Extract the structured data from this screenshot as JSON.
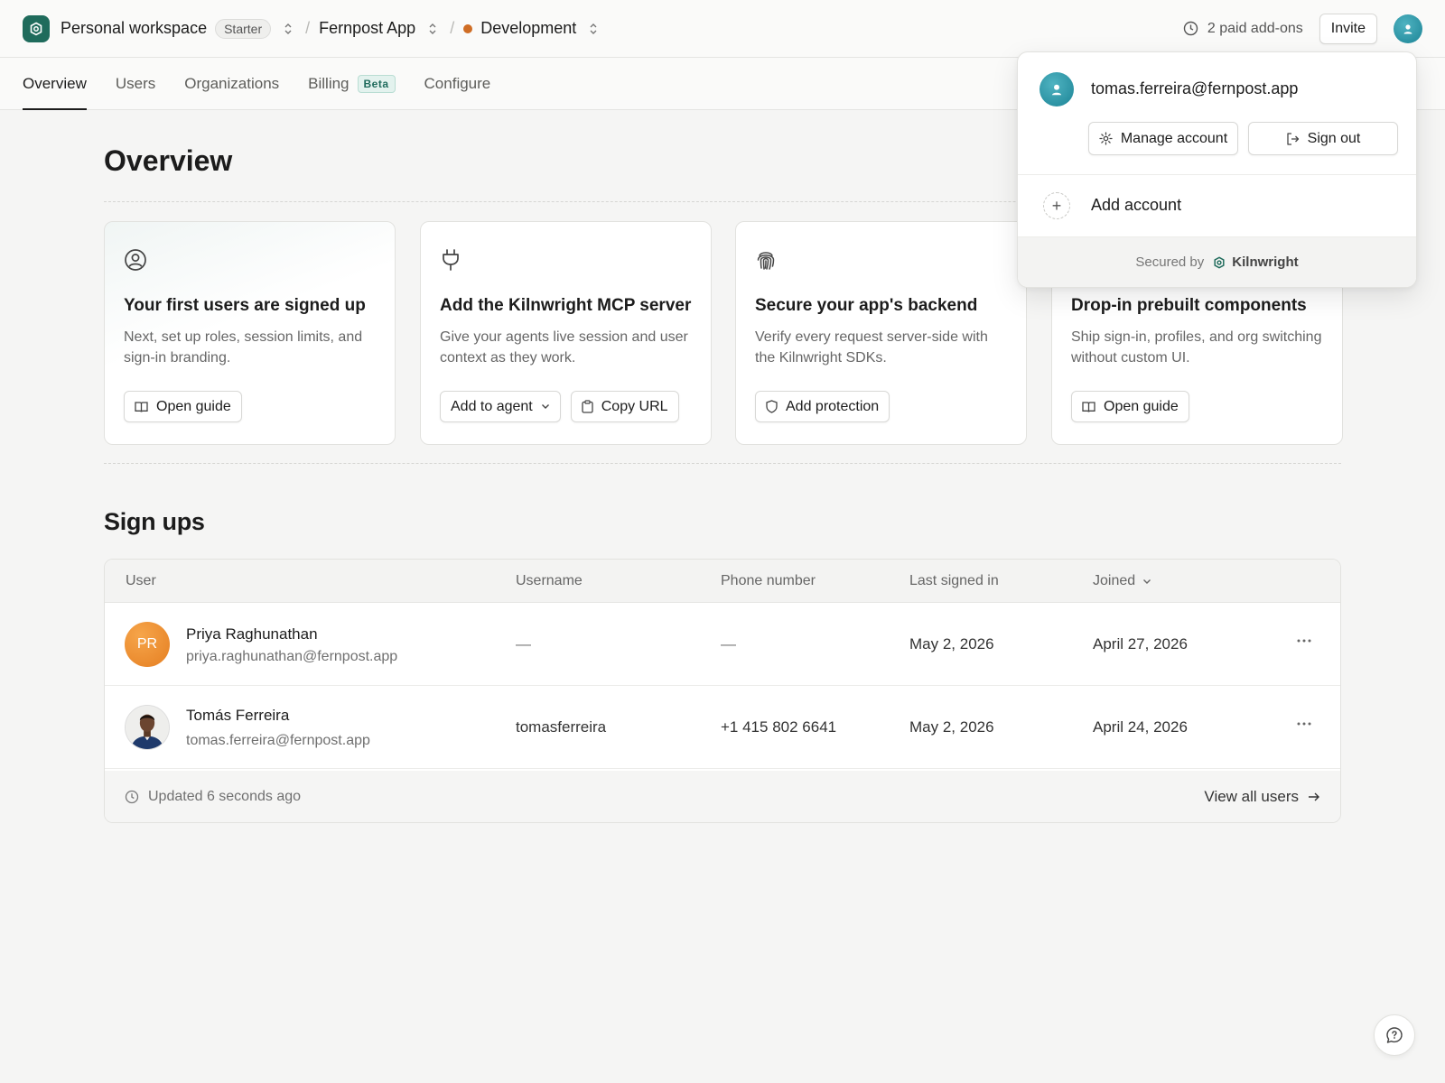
{
  "header": {
    "workspace": "Personal workspace",
    "plan": "Starter",
    "app": "Fernpost App",
    "environment": "Development",
    "addons": "2 paid add-ons",
    "invite": "Invite"
  },
  "tabs": [
    {
      "label": "Overview",
      "active": true
    },
    {
      "label": "Users"
    },
    {
      "label": "Organizations"
    },
    {
      "label": "Billing",
      "badge": "Beta"
    },
    {
      "label": "Configure"
    }
  ],
  "page": {
    "title": "Overview"
  },
  "cards": [
    {
      "icon": "user-circle-icon",
      "title": "Your first users are signed up",
      "desc": "Next, set up roles, session limits, and sign-in branding.",
      "actions": [
        {
          "label": "Open guide",
          "icon": "book-icon"
        }
      ]
    },
    {
      "icon": "plug-icon",
      "title": "Add the Kilnwright MCP server",
      "desc": "Give your agents live session and user context as they work.",
      "actions": [
        {
          "label": "Add to agent",
          "icon": "chevron-down-icon"
        },
        {
          "label": "Copy URL",
          "icon": "clipboard-icon"
        }
      ]
    },
    {
      "icon": "fingerprint-icon",
      "title": "Secure your app's backend",
      "desc": "Verify every request server-side with the Kilnwright SDKs.",
      "actions": [
        {
          "label": "Add protection",
          "icon": "shield-icon"
        }
      ]
    },
    {
      "icon": "components-icon",
      "title": "Drop-in prebuilt components",
      "desc": "Ship sign-in, profiles, and org switching without custom UI.",
      "actions": [
        {
          "label": "Open guide",
          "icon": "book-icon"
        }
      ]
    }
  ],
  "signups": {
    "title": "Sign ups",
    "columns": [
      "User",
      "Username",
      "Phone number",
      "Last signed in",
      "Joined"
    ],
    "rows": [
      {
        "initials": "PR",
        "name": "Priya Raghunathan",
        "email": "priya.raghunathan@fernpost.app",
        "username": "—",
        "phone": "—",
        "last_signed_in": "May 2, 2026",
        "joined": "April 27, 2026"
      },
      {
        "name": "Tomás Ferreira",
        "email": "tomas.ferreira@fernpost.app",
        "username": "tomasferreira",
        "phone": "+1 415 802 6641",
        "last_signed_in": "May 2, 2026",
        "joined": "April 24, 2026"
      }
    ],
    "updated": "Updated 6 seconds ago",
    "view_all": "View all users"
  },
  "account_menu": {
    "email": "tomas.ferreira@fernpost.app",
    "manage": "Manage account",
    "sign_out": "Sign out",
    "add_account": "Add account",
    "secured_by": "Secured by",
    "brand": "Kilnwright"
  },
  "colors": {
    "brand": "#1f6b5c",
    "env_dot": "#cf6d25",
    "avatar_teal": "#1c8496",
    "avatar_orange": "#ec8a2c"
  }
}
